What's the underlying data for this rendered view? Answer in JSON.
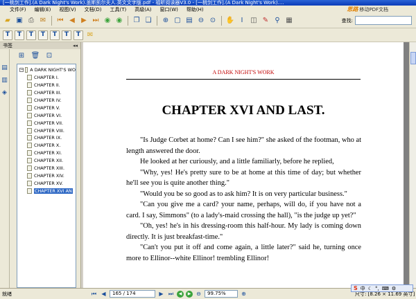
{
  "window": {
    "title": "[一桃剑工作].(A Dark Night's Work).盖斯凯尔夫人.英文文字版.pdf - 福昕阅读器V3.0 - [一桃剑工作].(A Dark Night's Work)...."
  },
  "menu": [
    "文件(F)",
    "编辑(E)",
    "视图(V)",
    "文档(D)",
    "工具(T)",
    "高级(A)",
    "窗口(W)",
    "帮助(H)"
  ],
  "brand": {
    "logo": "思路",
    "text": "移动PDF文档"
  },
  "search": {
    "label": "查找:",
    "value": ""
  },
  "toolbar1_icons": [
    "open-icon",
    "save-icon",
    "print-icon",
    "email-icon",
    "first-page-icon",
    "prev-page-icon",
    "next-page-icon",
    "last-page-icon",
    "back-icon",
    "forward-icon",
    "single-page-icon",
    "continuous-icon",
    "zoom-in-icon",
    "actual-size-icon",
    "fit-page-icon",
    "zoom-out-icon",
    "zoom-menu-icon",
    "hand-tool-icon",
    "select-tool-icon",
    "snapshot-icon",
    "annotate-icon",
    "find-icon",
    "image-icon"
  ],
  "toolbar2_icons": [
    "t1",
    "t2",
    "t3",
    "t4",
    "t5",
    "t6",
    "t7",
    "comment"
  ],
  "panel": {
    "title": "书签",
    "close": "◂◂"
  },
  "bookmarks": {
    "root": "A DARK NIGHT'S WO",
    "items": [
      "CHAPTER I.",
      "CHAPTER II.",
      "CHAPTER III.",
      "CHAPTER IV.",
      "CHAPTER V.",
      "CHAPTER VI.",
      "CHAPTER VII.",
      "CHAPTER VIII.",
      "CHAPTER IX.",
      "CHAPTER X.",
      "CHAPTER XI.",
      "CHAPTER XII.",
      "CHAPTER XIII.",
      "CHAPTER XIV.",
      "CHAPTER XV.",
      "CHAPTER XVI AN"
    ],
    "selected_index": 15
  },
  "document": {
    "running_head": "A DARK NIGHT'S WORK",
    "chapter_title": "CHAPTER XVI AND LAST.",
    "paragraphs": [
      "\"Is Judge Corbet at home? Can I see him?\" she asked of the footman, who at length answered the door.",
      "He looked at her curiously, and a little familiarly, before he replied,",
      "\"Why, yes! He's pretty sure to be at home at this time of day; but whether he'll see you is quite another thing.\"",
      "\"Would you be so good as to ask him? It is on very particular business.\"",
      "\"Can you give me a card? your name, perhaps, will do, if you have not a card. I say, Simmons\" (to a lady's-maid crossing the hall), \"is the judge up yet?\"",
      "\"Oh, yes! he's in his dressing-room this half-hour. My lady is coming down directly. It is just breakfast-time.\"",
      "\"Can't you put it off and come again, a little later?\" said he, turning once more to Ellinor--white Ellinor! trembling Ellinor!"
    ]
  },
  "status": {
    "ready": "就绪",
    "page": "165 / 174",
    "zoom": "99.75%",
    "size": "尺寸: [8.26 × 11.69 英寸]"
  },
  "ime": {
    "logo": "S",
    "label": "中"
  }
}
